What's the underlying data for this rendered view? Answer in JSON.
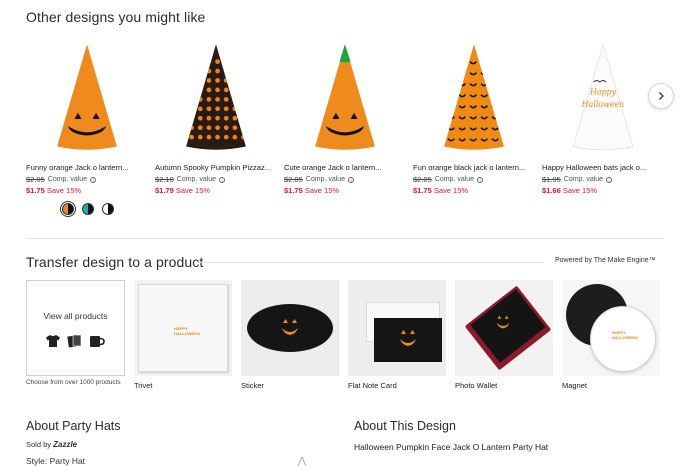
{
  "carousel": {
    "title": "Other designs you might like",
    "products": [
      {
        "title": "Funny orange Jack o lantern...",
        "old_price": "$2.05",
        "comp_label": "Comp. value",
        "sale_price": "$1.75",
        "save": "Save 15%",
        "hat": "orange-face",
        "tip": "#e98c1f"
      },
      {
        "title": "Autumn Spooky Pumpkin Pizzaz...",
        "old_price": "$2.10",
        "comp_label": "Comp. value",
        "sale_price": "$1.79",
        "save": "Save 15%",
        "hat": "pattern-dark",
        "tip": "#2a1a12"
      },
      {
        "title": "Cute orange Jack o lantern...",
        "old_price": "$2.05",
        "comp_label": "Comp. value",
        "sale_price": "$1.75",
        "save": "Save 15%",
        "hat": "orange-face-green",
        "tip": "#1fa33a"
      },
      {
        "title": "Fun orange black jack o lantern...",
        "old_price": "$2.05",
        "comp_label": "Comp. value",
        "sale_price": "$1.75",
        "save": "Save 15%",
        "hat": "pattern-orange",
        "tip": "#f08a12"
      },
      {
        "title": "Happy Halloween bats jack o...",
        "old_price": "$1.95",
        "comp_label": "Comp. value",
        "sale_price": "$1.66",
        "save": "Save 15%",
        "hat": "white-text",
        "tip": "#ffffff"
      }
    ],
    "swatch_colors": [
      [
        "#f08a12",
        "#111111"
      ],
      [
        "#1bb0a8",
        "#111111"
      ],
      [
        "#ffffff",
        "#111111"
      ]
    ],
    "hat_text": [
      "Happy",
      "Halloween"
    ]
  },
  "transfer": {
    "title": "Transfer design to a product",
    "powered_by": "Powered by The Make Engine™",
    "view_all": "View all products",
    "choose_text": "Choose from over 1000 products",
    "products": [
      {
        "label": "Trivet"
      },
      {
        "label": "Sticker"
      },
      {
        "label": "Flat Note Card"
      },
      {
        "label": "Photo Wallet"
      },
      {
        "label": "Magnet"
      }
    ],
    "mini_happy": [
      "HAPPY",
      "HALLOWEEN"
    ]
  },
  "about_hats": {
    "title": "About Party Hats",
    "sold_by_label": "Sold by",
    "seller": "Zazzle",
    "style": "Style: Party Hat"
  },
  "about_design": {
    "title": "About This Design",
    "name": "Halloween Pumpkin Face Jack O Lantern Party Hat"
  },
  "colors": {
    "accent_sale": "#e0142f",
    "pumpkin": "#f08a12"
  }
}
